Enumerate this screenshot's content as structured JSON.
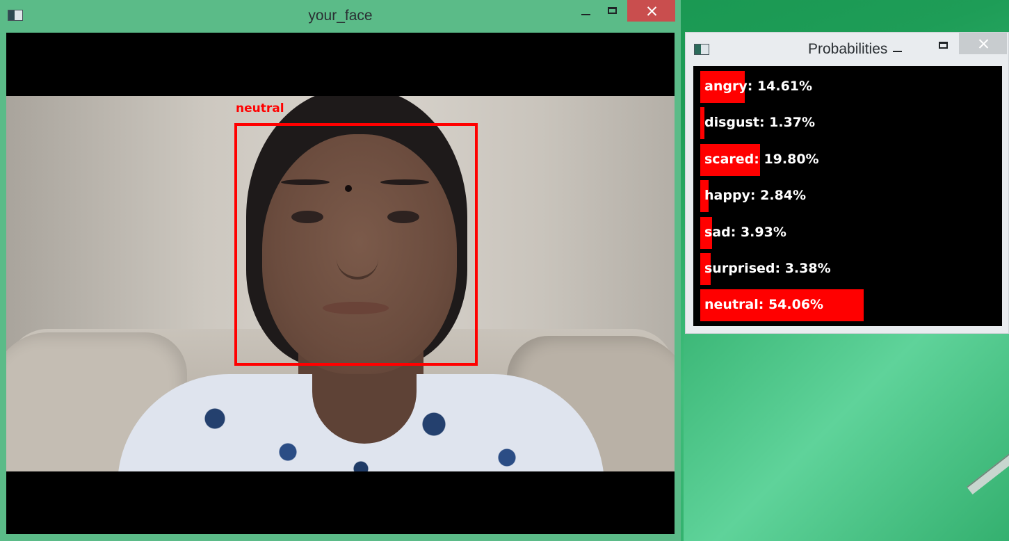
{
  "face_window": {
    "title": "your_face",
    "detection_label": "neutral"
  },
  "prob_window": {
    "title": "Probabilities",
    "rows": [
      {
        "label": "angry: 14.61%",
        "value": 14.61
      },
      {
        "label": "disgust: 1.37%",
        "value": 1.37
      },
      {
        "label": "scared: 19.80%",
        "value": 19.8
      },
      {
        "label": "happy: 2.84%",
        "value": 2.84
      },
      {
        "label": "sad: 3.93%",
        "value": 3.93
      },
      {
        "label": "surprised: 3.38%",
        "value": 3.38
      },
      {
        "label": "neutral: 54.06%",
        "value": 54.06
      }
    ],
    "bar_color": "#ff0000"
  },
  "colors": {
    "desktop": "#1e9d57",
    "window_frame": "#5bbb88",
    "close_button": "#c94e4e",
    "detection_box": "#ff0000"
  },
  "icons": {
    "window_icon": "app-window-icon",
    "minimize": "minimize-icon",
    "maximize": "maximize-icon",
    "close": "close-icon"
  }
}
